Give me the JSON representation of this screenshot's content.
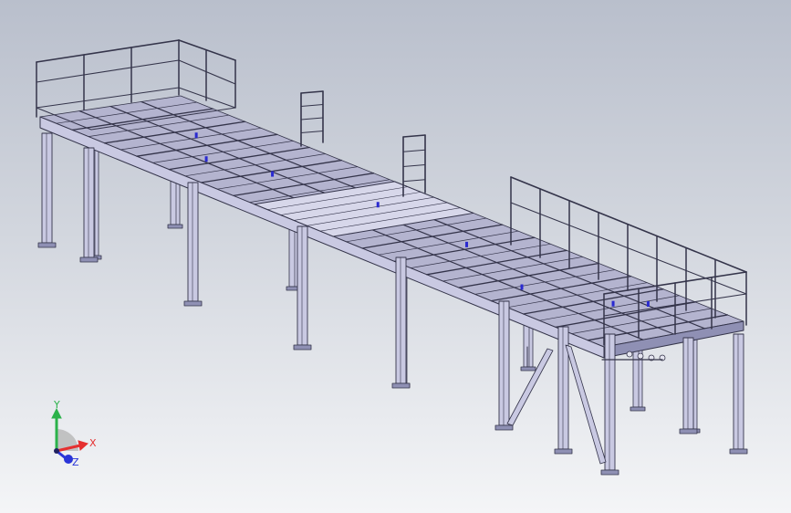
{
  "viewport": {
    "background_top": "#b9bfcc",
    "background_bottom": "#f4f5f7"
  },
  "model": {
    "colors": {
      "steel_fill": "#c9c9e2",
      "steel_dark": "#8f90b4",
      "deck_fill": "#b4b4cf",
      "edge": "#34344a",
      "bolt": "#2a2ad0"
    }
  },
  "triad": {
    "x_label": "X",
    "y_label": "Y",
    "z_label": "Z",
    "x_color": "#e53030",
    "y_color": "#2bb24a",
    "z_color": "#2a35d8"
  }
}
